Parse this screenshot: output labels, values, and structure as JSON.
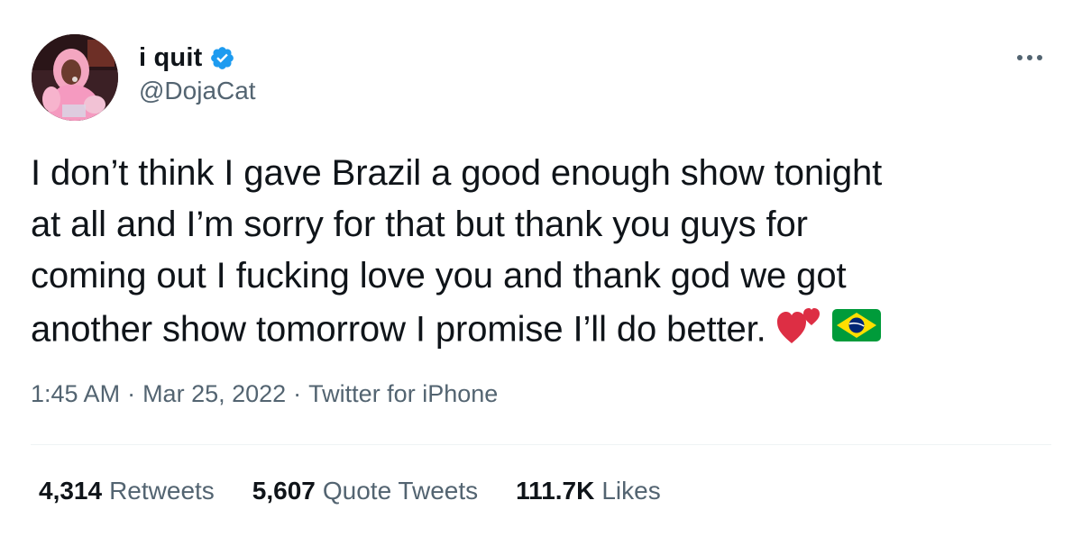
{
  "author": {
    "display_name": "i quit",
    "handle": "@DojaCat",
    "verified": true,
    "verified_color": "#1d9bf0"
  },
  "tweet": {
    "text_lines": [
      "I don’t think I gave Brazil a good enough show tonight",
      "at all and I’m sorry for that but thank you guys for",
      "coming out I fucking love you and thank god we got",
      "another show tomorrow I promise I’ll do better."
    ],
    "emojis": [
      "two-hearts-icon",
      "brazil-flag-icon"
    ]
  },
  "meta": {
    "time": "1:45 AM",
    "separator": "·",
    "date": "Mar 25, 2022",
    "source": "Twitter for iPhone"
  },
  "stats": {
    "retweets_count": "4,314",
    "retweets_label": "Retweets",
    "quotes_count": "5,607",
    "quotes_label": "Quote Tweets",
    "likes_count": "111.7K",
    "likes_label": "Likes"
  },
  "colors": {
    "text_primary": "#0f1419",
    "text_secondary": "#536471",
    "divider": "#eff3f4"
  }
}
